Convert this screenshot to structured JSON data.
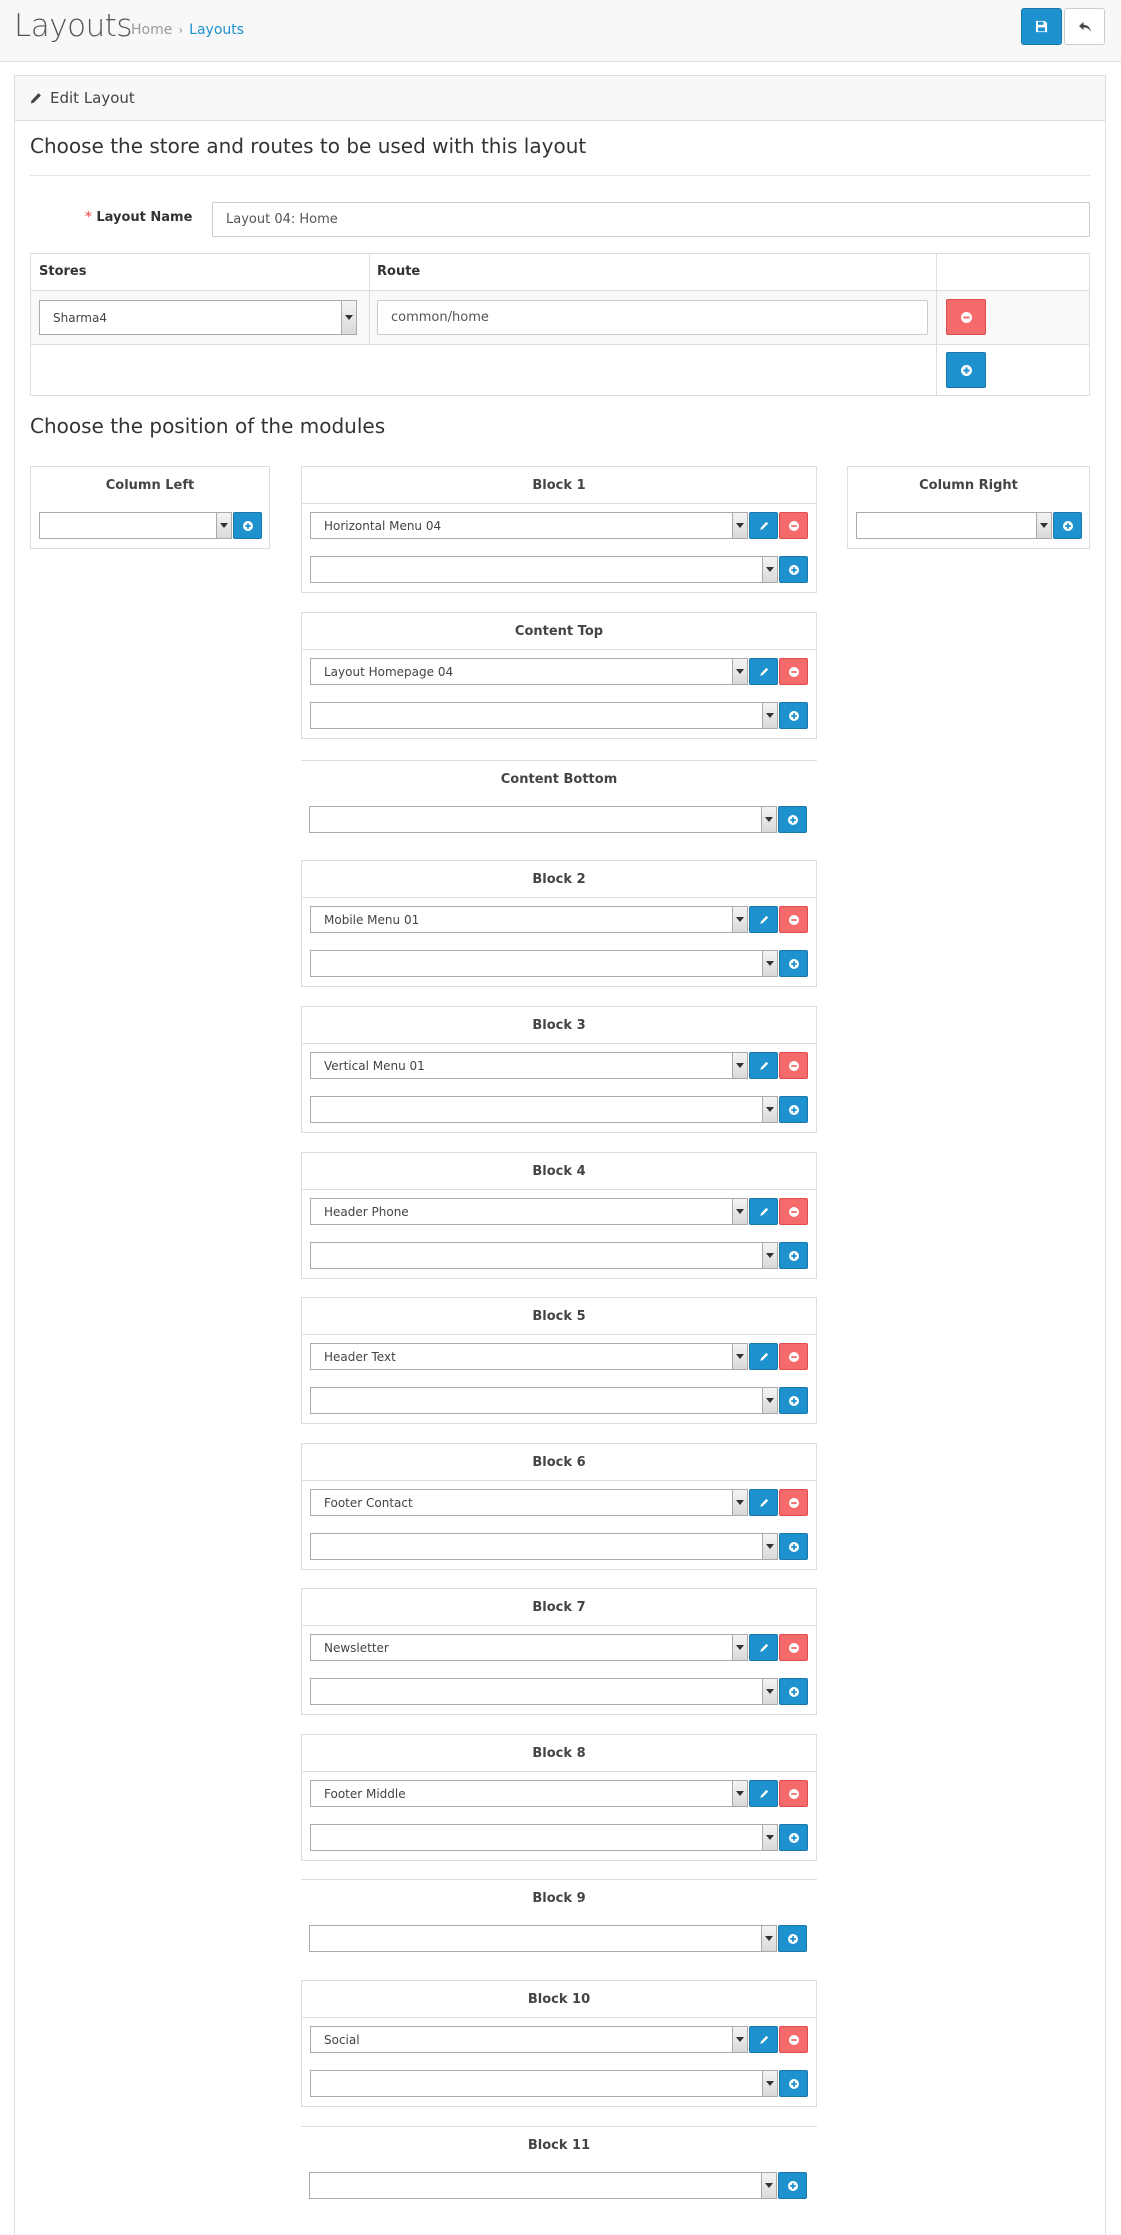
{
  "header": {
    "title": "Layouts",
    "breadcrumb": [
      "Home",
      "Layouts"
    ],
    "save_icon": "save-icon",
    "back_icon": "reply-icon"
  },
  "panel": {
    "heading": "Edit Layout",
    "legend_routes": "Choose the store and routes to be used with this layout",
    "layout_name_label": "Layout Name",
    "layout_name_value": "Layout 04: Home",
    "table": {
      "col_stores": "Stores",
      "col_route": "Route",
      "store_value": "Sharma4",
      "route_value": "common/home"
    },
    "legend_modules": "Choose the position of the modules"
  },
  "positions": {
    "column_left": {
      "title": "Column Left"
    },
    "column_right": {
      "title": "Column Right"
    },
    "center": [
      {
        "title": "Block 1",
        "module": "Horizontal Menu 04"
      },
      {
        "title": "Content Top",
        "module": "Layout Homepage 04"
      },
      {
        "title": "Content Bottom",
        "module": ""
      },
      {
        "title": "Block 2",
        "module": "Mobile Menu 01"
      },
      {
        "title": "Block 3",
        "module": "Vertical Menu 01"
      },
      {
        "title": "Block 4",
        "module": "Header Phone"
      },
      {
        "title": "Block 5",
        "module": "Header Text"
      },
      {
        "title": "Block 6",
        "module": "Footer Contact"
      },
      {
        "title": "Block 7",
        "module": "Newsletter"
      },
      {
        "title": "Block 8",
        "module": "Footer Middle"
      },
      {
        "title": "Block 9",
        "module": ""
      },
      {
        "title": "Block 10",
        "module": "Social"
      },
      {
        "title": "Block 11",
        "module": ""
      }
    ]
  },
  "colors": {
    "primary": "#1e91cf",
    "danger": "#f56b6b"
  }
}
